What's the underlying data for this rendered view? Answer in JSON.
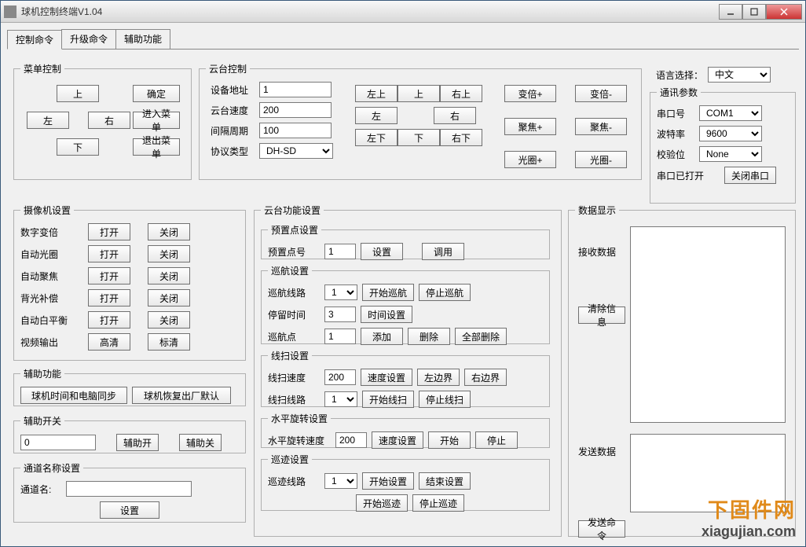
{
  "window_title": "球机控制终端V1.04",
  "tabs": {
    "control": "控制命令",
    "upgrade": "升级命令",
    "aux": "辅助功能"
  },
  "menu_ctrl": {
    "legend": "菜单控制",
    "up": "上",
    "down": "下",
    "left": "左",
    "right": "右",
    "ok": "确定",
    "enter_menu": "进入菜单",
    "exit_menu": "退出菜单"
  },
  "ptz_ctrl": {
    "legend": "云台控制",
    "addr_label": "设备地址",
    "addr": "1",
    "speed_label": "云台速度",
    "speed": "200",
    "interval_label": "间隔周期",
    "interval": "100",
    "proto_label": "协议类型",
    "proto": "DH-SD",
    "tl": "左上",
    "t": "上",
    "tr": "右上",
    "l": "左",
    "r": "右",
    "bl": "左下",
    "b": "下",
    "br": "右下",
    "zoom_in": "变倍+",
    "zoom_out": "变倍-",
    "focus_in": "聚焦+",
    "focus_out": "聚焦-",
    "iris_in": "光圈+",
    "iris_out": "光圈-"
  },
  "lang": {
    "label": "语言选择：",
    "value": "中文"
  },
  "comm": {
    "legend": "通讯参数",
    "port_label": "串口号",
    "port": "COM1",
    "baud_label": "波特率",
    "baud": "9600",
    "parity_label": "校验位",
    "parity": "None",
    "status": "串口已打开",
    "close_btn": "关闭串口"
  },
  "camera": {
    "legend": "摄像机设置",
    "dzoom": "数字变倍",
    "airis": "自动光圈",
    "afocus": "自动聚焦",
    "blc": "背光补偿",
    "awb": "自动白平衡",
    "vout": "视频输出",
    "open": "打开",
    "close": "关闭",
    "hd": "高清",
    "sd": "标清"
  },
  "aux_fn": {
    "legend": "辅助功能",
    "sync_time": "球机时间和电脑同步",
    "factory_reset": "球机恢复出厂默认"
  },
  "aux_switch": {
    "legend": "辅助开关",
    "value": "0",
    "on": "辅助开",
    "off": "辅助关"
  },
  "channel_name": {
    "legend": "通道名称设置",
    "label": "通道名:",
    "value": "",
    "set": "设置"
  },
  "ptz_fn": {
    "legend": "云台功能设置",
    "preset": {
      "legend": "预置点设置",
      "label": "预置点号",
      "num": "1",
      "set": "设置",
      "call": "调用"
    },
    "cruise": {
      "legend": "巡航设置",
      "route_label": "巡航线路",
      "route": "1",
      "start": "开始巡航",
      "stop": "停止巡航",
      "stay_label": "停留时间",
      "stay": "3",
      "time_set": "时间设置",
      "point_label": "巡航点",
      "point": "1",
      "add": "添加",
      "del": "删除",
      "del_all": "全部删除"
    },
    "linescan": {
      "legend": "线扫设置",
      "speed_label": "线扫速度",
      "speed": "200",
      "speed_set": "速度设置",
      "left_b": "左边界",
      "right_b": "右边界",
      "route_label": "线扫线路",
      "route": "1",
      "start": "开始线扫",
      "stop": "停止线扫"
    },
    "hrot": {
      "legend": "水平旋转设置",
      "speed_label": "水平旋转速度",
      "speed": "200",
      "speed_set": "速度设置",
      "start": "开始",
      "stop": "停止"
    },
    "tour": {
      "legend": "巡迹设置",
      "route_label": "巡迹线路",
      "route": "1",
      "start_set": "开始设置",
      "end_set": "结束设置",
      "start": "开始巡迹",
      "stop": "停止巡迹"
    }
  },
  "data_disp": {
    "legend": "数据显示",
    "recv_label": "接收数据",
    "clear": "清除信息",
    "send_label": "发送数据",
    "send": "发送命令"
  },
  "watermark": {
    "text": "下固件网",
    "url": "xiagujian.com"
  }
}
